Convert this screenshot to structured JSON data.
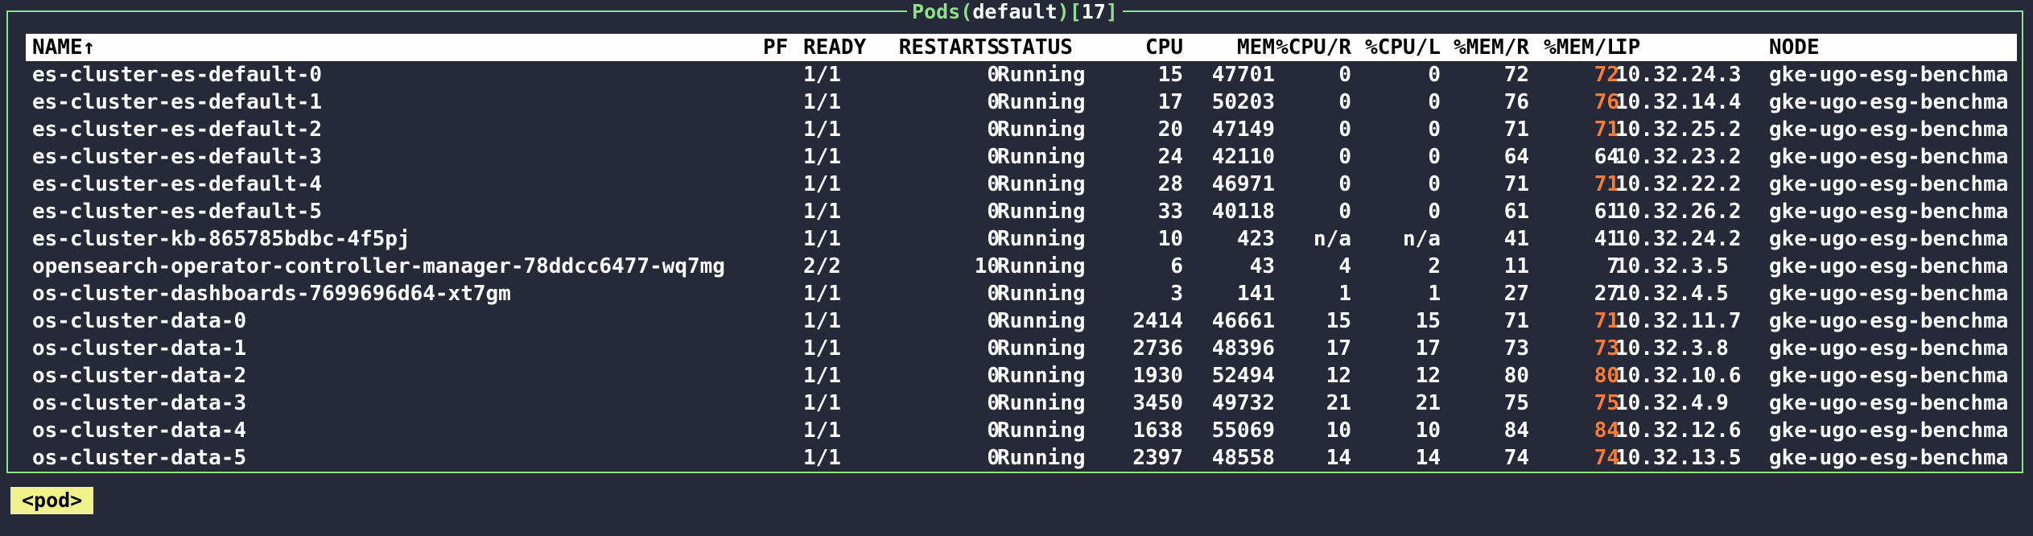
{
  "header": {
    "resource": "Pods",
    "namespace": "default",
    "count": "17",
    "open_paren": "(",
    "close_paren": ")",
    "open_bracket": "[",
    "close_bracket": "]"
  },
  "colors": {
    "background": "#262a38",
    "frame": "#8fe08a",
    "warn": "#ff7a33",
    "crumb_bg": "#f0f28a"
  },
  "columns": {
    "name": "NAME↑",
    "pf": "PF",
    "ready": "READY",
    "restarts": "RESTARTS",
    "status": "STATUS",
    "cpu": "CPU",
    "mem": "MEM",
    "cpu_r": "%CPU/R",
    "cpu_l": "%CPU/L",
    "mem_r": "%MEM/R",
    "mem_l": "%MEM/L",
    "ip": "IP",
    "node": "NODE"
  },
  "rows": [
    {
      "name": "es-cluster-es-default-0",
      "pf": "",
      "ready": "1/1",
      "restarts": "0",
      "status": "Running",
      "cpu": "15",
      "mem": "47701",
      "cpu_r": "0",
      "cpu_l": "0",
      "mem_r": "72",
      "mem_l": "72",
      "mem_l_warn": true,
      "ip": "10.32.24.3",
      "node": "gke-ugo-esg-benchma"
    },
    {
      "name": "es-cluster-es-default-1",
      "pf": "",
      "ready": "1/1",
      "restarts": "0",
      "status": "Running",
      "cpu": "17",
      "mem": "50203",
      "cpu_r": "0",
      "cpu_l": "0",
      "mem_r": "76",
      "mem_l": "76",
      "mem_l_warn": true,
      "ip": "10.32.14.4",
      "node": "gke-ugo-esg-benchma"
    },
    {
      "name": "es-cluster-es-default-2",
      "pf": "",
      "ready": "1/1",
      "restarts": "0",
      "status": "Running",
      "cpu": "20",
      "mem": "47149",
      "cpu_r": "0",
      "cpu_l": "0",
      "mem_r": "71",
      "mem_l": "71",
      "mem_l_warn": true,
      "ip": "10.32.25.2",
      "node": "gke-ugo-esg-benchma"
    },
    {
      "name": "es-cluster-es-default-3",
      "pf": "",
      "ready": "1/1",
      "restarts": "0",
      "status": "Running",
      "cpu": "24",
      "mem": "42110",
      "cpu_r": "0",
      "cpu_l": "0",
      "mem_r": "64",
      "mem_l": "64",
      "mem_l_warn": false,
      "ip": "10.32.23.2",
      "node": "gke-ugo-esg-benchma"
    },
    {
      "name": "es-cluster-es-default-4",
      "pf": "",
      "ready": "1/1",
      "restarts": "0",
      "status": "Running",
      "cpu": "28",
      "mem": "46971",
      "cpu_r": "0",
      "cpu_l": "0",
      "mem_r": "71",
      "mem_l": "71",
      "mem_l_warn": true,
      "ip": "10.32.22.2",
      "node": "gke-ugo-esg-benchma"
    },
    {
      "name": "es-cluster-es-default-5",
      "pf": "",
      "ready": "1/1",
      "restarts": "0",
      "status": "Running",
      "cpu": "33",
      "mem": "40118",
      "cpu_r": "0",
      "cpu_l": "0",
      "mem_r": "61",
      "mem_l": "61",
      "mem_l_warn": false,
      "ip": "10.32.26.2",
      "node": "gke-ugo-esg-benchma"
    },
    {
      "name": "es-cluster-kb-865785bdbc-4f5pj",
      "pf": "",
      "ready": "1/1",
      "restarts": "0",
      "status": "Running",
      "cpu": "10",
      "mem": "423",
      "cpu_r": "n/a",
      "cpu_l": "n/a",
      "mem_r": "41",
      "mem_l": "41",
      "mem_l_warn": false,
      "ip": "10.32.24.2",
      "node": "gke-ugo-esg-benchma"
    },
    {
      "name": "opensearch-operator-controller-manager-78ddcc6477-wq7mg",
      "pf": "",
      "ready": "2/2",
      "restarts": "10",
      "status": "Running",
      "cpu": "6",
      "mem": "43",
      "cpu_r": "4",
      "cpu_l": "2",
      "mem_r": "11",
      "mem_l": "7",
      "mem_l_warn": false,
      "ip": "10.32.3.5",
      "node": "gke-ugo-esg-benchma"
    },
    {
      "name": "os-cluster-dashboards-7699696d64-xt7gm",
      "pf": "",
      "ready": "1/1",
      "restarts": "0",
      "status": "Running",
      "cpu": "3",
      "mem": "141",
      "cpu_r": "1",
      "cpu_l": "1",
      "mem_r": "27",
      "mem_l": "27",
      "mem_l_warn": false,
      "ip": "10.32.4.5",
      "node": "gke-ugo-esg-benchma"
    },
    {
      "name": "os-cluster-data-0",
      "pf": "",
      "ready": "1/1",
      "restarts": "0",
      "status": "Running",
      "cpu": "2414",
      "mem": "46661",
      "cpu_r": "15",
      "cpu_l": "15",
      "mem_r": "71",
      "mem_l": "71",
      "mem_l_warn": true,
      "ip": "10.32.11.7",
      "node": "gke-ugo-esg-benchma"
    },
    {
      "name": "os-cluster-data-1",
      "pf": "",
      "ready": "1/1",
      "restarts": "0",
      "status": "Running",
      "cpu": "2736",
      "mem": "48396",
      "cpu_r": "17",
      "cpu_l": "17",
      "mem_r": "73",
      "mem_l": "73",
      "mem_l_warn": true,
      "ip": "10.32.3.8",
      "node": "gke-ugo-esg-benchma"
    },
    {
      "name": "os-cluster-data-2",
      "pf": "",
      "ready": "1/1",
      "restarts": "0",
      "status": "Running",
      "cpu": "1930",
      "mem": "52494",
      "cpu_r": "12",
      "cpu_l": "12",
      "mem_r": "80",
      "mem_l": "80",
      "mem_l_warn": true,
      "ip": "10.32.10.6",
      "node": "gke-ugo-esg-benchma"
    },
    {
      "name": "os-cluster-data-3",
      "pf": "",
      "ready": "1/1",
      "restarts": "0",
      "status": "Running",
      "cpu": "3450",
      "mem": "49732",
      "cpu_r": "21",
      "cpu_l": "21",
      "mem_r": "75",
      "mem_l": "75",
      "mem_l_warn": true,
      "ip": "10.32.4.9",
      "node": "gke-ugo-esg-benchma"
    },
    {
      "name": "os-cluster-data-4",
      "pf": "",
      "ready": "1/1",
      "restarts": "0",
      "status": "Running",
      "cpu": "1638",
      "mem": "55069",
      "cpu_r": "10",
      "cpu_l": "10",
      "mem_r": "84",
      "mem_l": "84",
      "mem_l_warn": true,
      "ip": "10.32.12.6",
      "node": "gke-ugo-esg-benchma"
    },
    {
      "name": "os-cluster-data-5",
      "pf": "",
      "ready": "1/1",
      "restarts": "0",
      "status": "Running",
      "cpu": "2397",
      "mem": "48558",
      "cpu_r": "14",
      "cpu_l": "14",
      "mem_r": "74",
      "mem_l": "74",
      "mem_l_warn": true,
      "ip": "10.32.13.5",
      "node": "gke-ugo-esg-benchma"
    }
  ],
  "crumbs": {
    "current": "<pod>"
  }
}
